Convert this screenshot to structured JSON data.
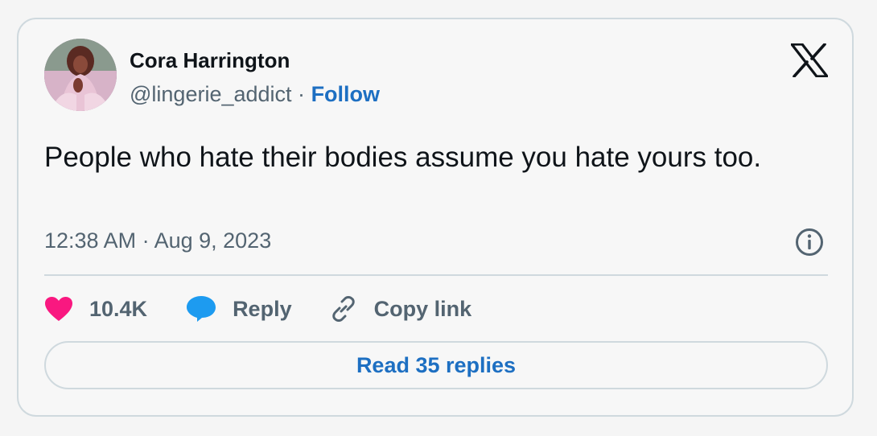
{
  "author": {
    "name": "Cora Harrington",
    "handle": "@lingerie_addict",
    "separator": "·",
    "follow_label": "Follow",
    "avatar_icon": "avatar-photo"
  },
  "tweet": {
    "text": "People who hate their bodies assume you hate yours too.",
    "timestamp": "12:38 AM · Aug 9, 2023"
  },
  "actions": {
    "like_count": "10.4K",
    "reply_label": "Reply",
    "copy_link_label": "Copy link"
  },
  "footer": {
    "read_replies_label": "Read 35 replies"
  },
  "icons": {
    "brand": "x-logo-icon",
    "info": "info-icon",
    "like": "heart-icon",
    "reply": "speech-bubble-icon",
    "copy": "link-icon"
  },
  "colors": {
    "like": "#f91880",
    "reply": "#1d9bf0",
    "link_accent": "#1d6fc2",
    "muted_text": "#536471",
    "border": "#cfd9de"
  }
}
